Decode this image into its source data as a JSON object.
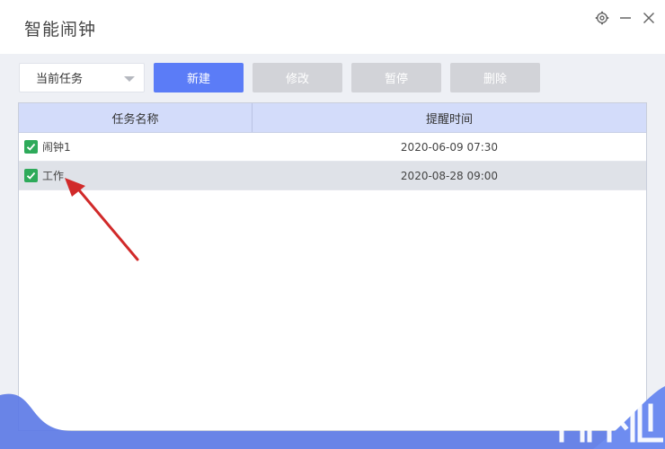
{
  "window": {
    "title": "智能闹钟",
    "controls": [
      "settings-icon",
      "minimize-icon",
      "close-icon"
    ]
  },
  "toolbar": {
    "filter_value": "当前任务",
    "new_label": "新建",
    "edit_label": "修改",
    "pause_label": "暂停",
    "delete_label": "删除"
  },
  "table": {
    "headers": [
      "任务名称",
      "提醒时间"
    ],
    "rows": [
      {
        "name": "闹钟1",
        "time": "2020-06-09 07:30",
        "checked": true,
        "selected": false
      },
      {
        "name": "工作",
        "time": "2020-08-28 09:00",
        "checked": true,
        "selected": true
      }
    ]
  },
  "colors": {
    "primary": "#5b7cf7",
    "disabled": "#d2d3d8",
    "header_bg": "#d3dcfa",
    "check": "#2eaa5a",
    "arrow": "#d12a2a"
  }
}
